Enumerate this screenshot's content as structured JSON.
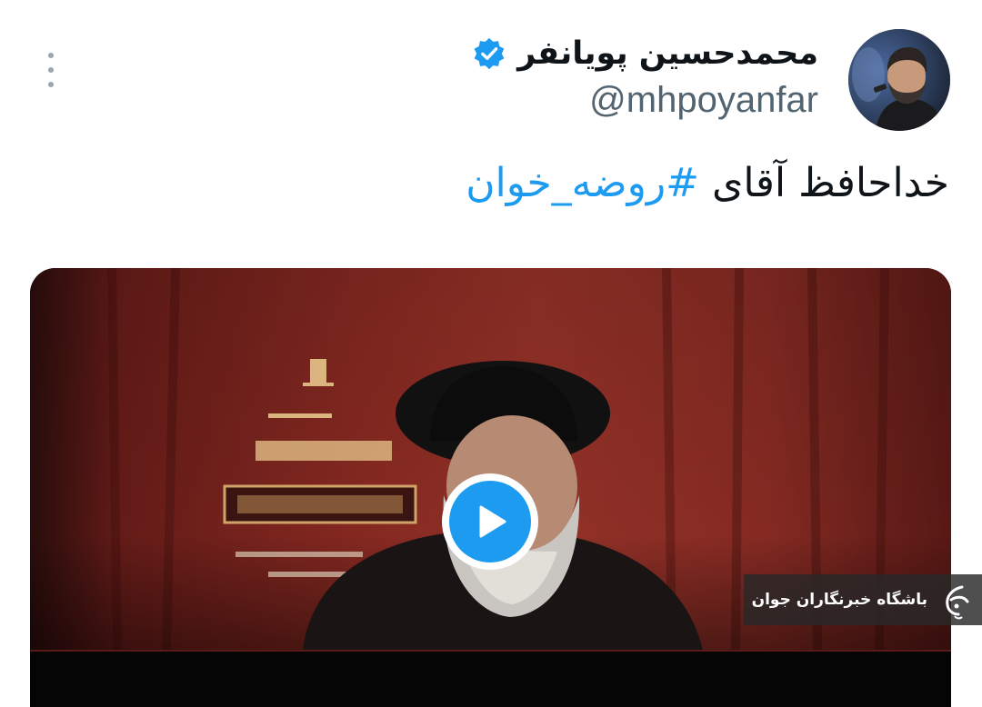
{
  "tweet": {
    "author": {
      "display_name": "محمدحسین پویانفر",
      "handle": "@mhpoyanfar",
      "verified": true,
      "verified_icon": "verified-badge-icon",
      "avatar_icon": "user-avatar"
    },
    "more_icon": "more-vertical-icon",
    "text_prefix": "خداحافظ آقای ",
    "hashtag": "#روضه_خوان",
    "media": {
      "type": "video",
      "play_icon": "play-icon",
      "watermark_text": "باشگاه خبرنگاران جوان",
      "watermark_logo": "yjc-logo"
    }
  },
  "colors": {
    "accent": "#1d9bf0",
    "text_primary": "#0f1419",
    "text_secondary": "#536471"
  }
}
